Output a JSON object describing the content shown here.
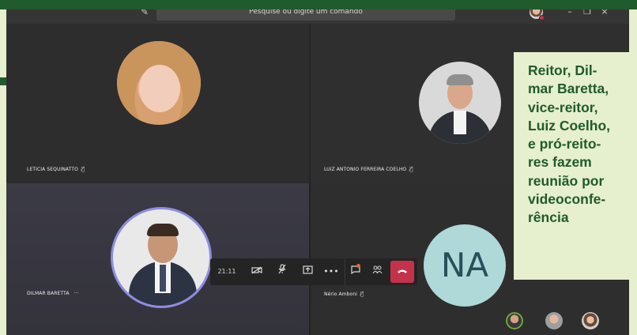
{
  "window": {
    "search_placeholder": "Pesquise ou digite um comando",
    "controls": {
      "minimize": "–",
      "maximize": "❐",
      "close": "×"
    }
  },
  "participants": [
    {
      "name": "LETICIA SEQUINATTO",
      "mic_icon": "mic-off-icon"
    },
    {
      "name": "LUIZ ANTONIO FERREIRA COELHO",
      "mic_icon": "mic-off-icon"
    },
    {
      "name": "DILMAR BARETTA",
      "more": "···"
    },
    {
      "name": "Nério Amboni",
      "initials": "NA",
      "mic_icon": "mic-off-icon"
    }
  ],
  "call_controls": {
    "elapsed_time": "21:11",
    "more": "•••"
  },
  "caption": {
    "text": "Reitor, Dil-\nmar Baretta,\nvice-reitor,\nLuiz Coelho,\ne pró-reito-\nres fazem\nreunião por\nvideoconfe-\nrência"
  },
  "colors": {
    "brand_green": "#1f5b2c",
    "caption_bg": "#e6efce",
    "hangup": "#c4314b",
    "initials_bg": "#aed9d8",
    "speaking_ring": "#8f8ce0"
  }
}
